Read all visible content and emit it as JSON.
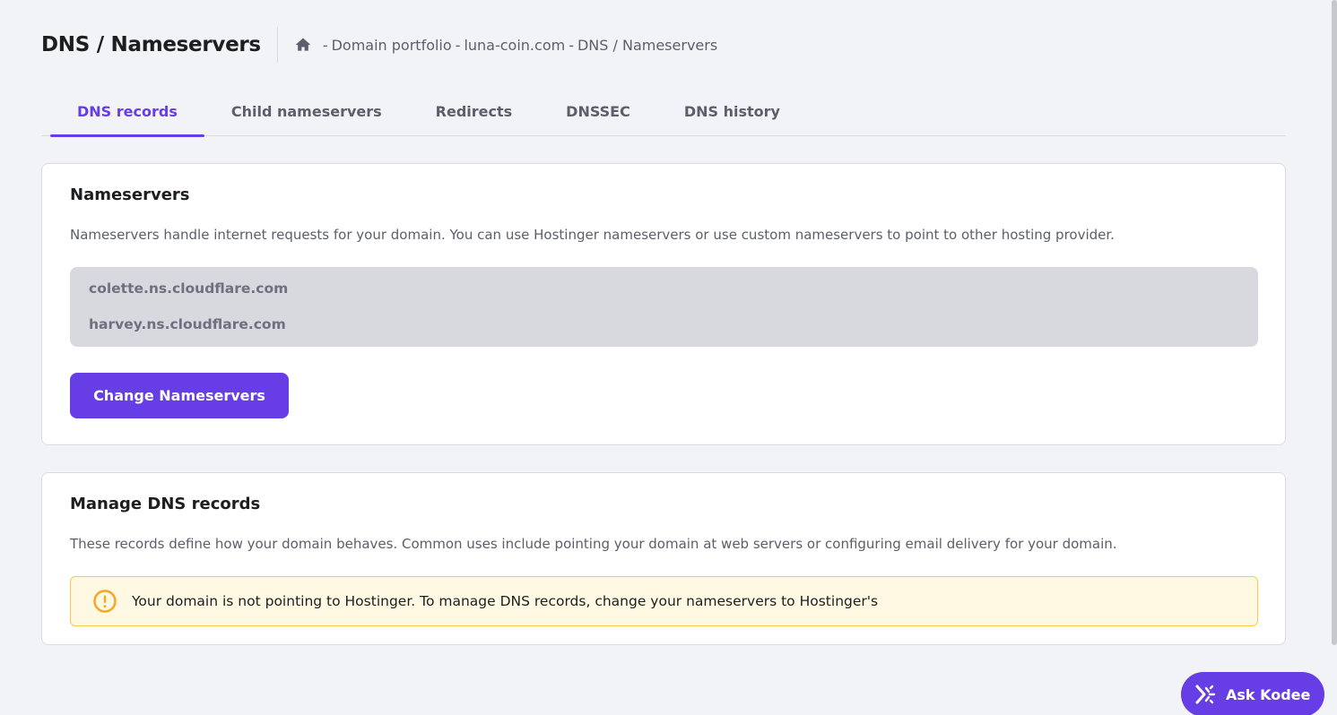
{
  "header": {
    "title": "DNS / Nameservers",
    "breadcrumb": [
      "Domain portfolio",
      "luna-coin.com",
      "DNS / Nameservers"
    ],
    "separator": "-"
  },
  "tabs": [
    {
      "label": "DNS records",
      "active": true
    },
    {
      "label": "Child nameservers",
      "active": false
    },
    {
      "label": "Redirects",
      "active": false
    },
    {
      "label": "DNSSEC",
      "active": false
    },
    {
      "label": "DNS history",
      "active": false
    }
  ],
  "nameservers_card": {
    "title": "Nameservers",
    "description": "Nameservers handle internet requests for your domain. You can use Hostinger nameservers or use custom nameservers to point to other hosting provider.",
    "nameservers": [
      "colette.ns.cloudflare.com",
      "harvey.ns.cloudflare.com"
    ],
    "button_label": "Change Nameservers"
  },
  "dns_card": {
    "title": "Manage DNS records",
    "description": "These records define how your domain behaves. Common uses include pointing your domain at web servers or configuring email delivery for your domain.",
    "alert_text": "Your domain is not pointing to Hostinger. To manage DNS records, change your nameservers to Hostinger's"
  },
  "assistant": {
    "label": "Ask Kodee"
  },
  "colors": {
    "accent": "#673de6",
    "warning": "#f5a623"
  }
}
